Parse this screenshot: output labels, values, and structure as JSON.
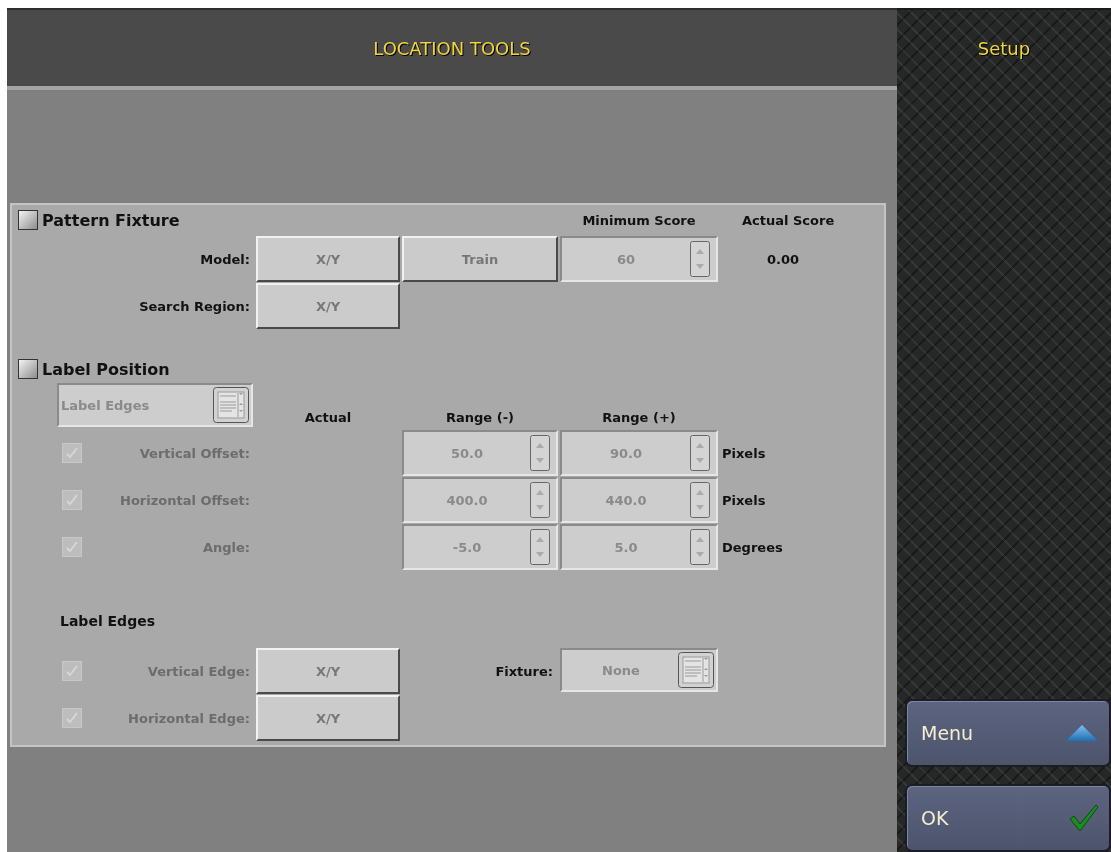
{
  "header": {
    "title": "LOCATION TOOLS",
    "mode": "Setup"
  },
  "pattern_fixture": {
    "label": "Pattern Fixture",
    "checked": false,
    "minimum_score_heading": "Minimum Score",
    "actual_score_heading": "Actual Score",
    "model": {
      "label": "Model:",
      "button": "X/Y",
      "train_button": "Train",
      "minimum_score": "60",
      "actual_score": "0.00"
    },
    "search_region": {
      "label": "Search Region:",
      "button": "X/Y"
    }
  },
  "label_position": {
    "label": "Label Position",
    "checked": false,
    "mode_dropdown": "Label Edges",
    "headings": [
      "Actual",
      "Range (-)",
      "Range (+)"
    ],
    "rows": [
      {
        "label": "Vertical Offset:",
        "checked": true,
        "disabled": true,
        "range_min": "50.0",
        "range_max": "90.0",
        "unit": "Pixels"
      },
      {
        "label": "Horizontal Offset:",
        "checked": true,
        "disabled": true,
        "range_min": "400.0",
        "range_max": "440.0",
        "unit": "Pixels"
      },
      {
        "label": "Angle:",
        "checked": true,
        "disabled": true,
        "range_min": "-5.0",
        "range_max": "5.0",
        "unit": "Degrees"
      }
    ]
  },
  "label_edges": {
    "heading": "Label Edges",
    "rows": [
      {
        "label": "Vertical Edge:",
        "checked": true,
        "disabled": true,
        "button": "X/Y"
      },
      {
        "label": "Horizontal Edge:",
        "checked": true,
        "disabled": true,
        "button": "X/Y"
      }
    ],
    "fixture": {
      "label": "Fixture:",
      "value": "None"
    }
  },
  "sidebar": {
    "buttons": [
      {
        "label": "Menu",
        "kind": "menu"
      },
      {
        "label": "OK",
        "kind": "ok"
      }
    ]
  }
}
